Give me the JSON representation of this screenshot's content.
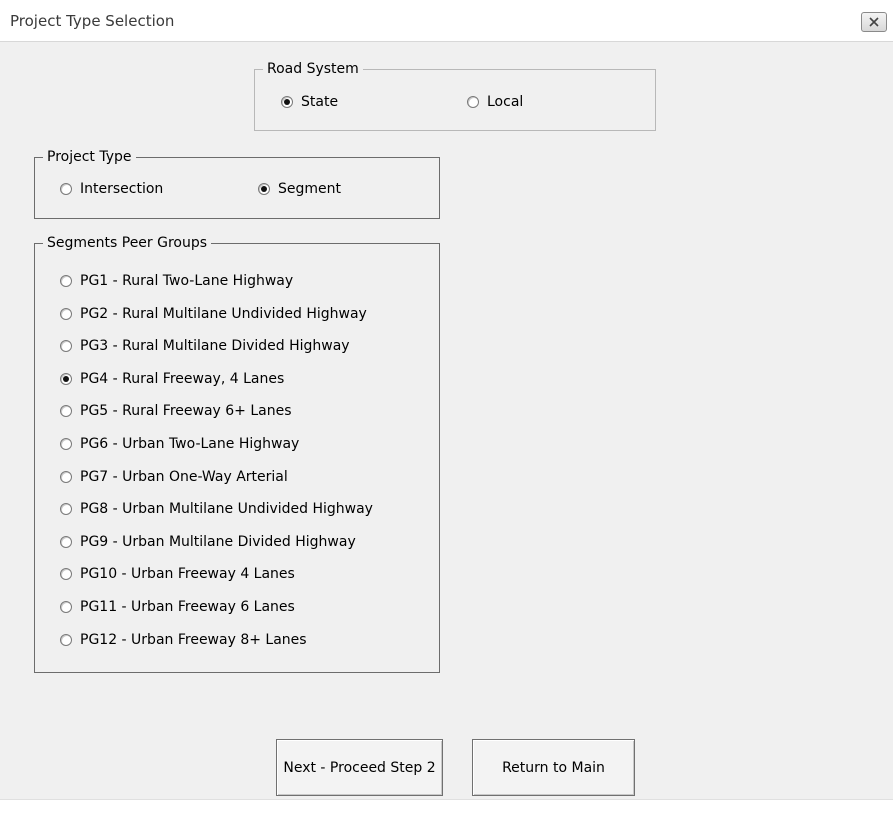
{
  "window": {
    "title": "Project Type Selection",
    "close_icon": "close-icon"
  },
  "road_system": {
    "label": "Road System",
    "options": [
      {
        "label": "State",
        "checked": true
      },
      {
        "label": "Local",
        "checked": false
      }
    ]
  },
  "project_type": {
    "label": "Project Type",
    "options": [
      {
        "label": "Intersection",
        "checked": false
      },
      {
        "label": "Segment",
        "checked": true
      }
    ]
  },
  "peer_groups": {
    "label": "Segments Peer Groups",
    "options": [
      {
        "label": "PG1 - Rural Two-Lane Highway",
        "checked": false
      },
      {
        "label": "PG2 - Rural Multilane Undivided Highway",
        "checked": false
      },
      {
        "label": "PG3 - Rural Multilane Divided Highway",
        "checked": false
      },
      {
        "label": "PG4 - Rural Freeway, 4 Lanes",
        "checked": true
      },
      {
        "label": "PG5 - Rural Freeway 6+ Lanes",
        "checked": false
      },
      {
        "label": "PG6 - Urban Two-Lane Highway",
        "checked": false
      },
      {
        "label": "PG7 - Urban One-Way Arterial",
        "checked": false
      },
      {
        "label": "PG8 - Urban Multilane Undivided Highway",
        "checked": false
      },
      {
        "label": "PG9 - Urban Multilane Divided Highway",
        "checked": false
      },
      {
        "label": "PG10 - Urban Freeway 4 Lanes",
        "checked": false
      },
      {
        "label": "PG11 - Urban Freeway 6 Lanes",
        "checked": false
      },
      {
        "label": "PG12 - Urban Freeway 8+ Lanes",
        "checked": false
      }
    ]
  },
  "buttons": {
    "next_label": "Next - Proceed Step 2",
    "return_label": "Return to Main"
  }
}
